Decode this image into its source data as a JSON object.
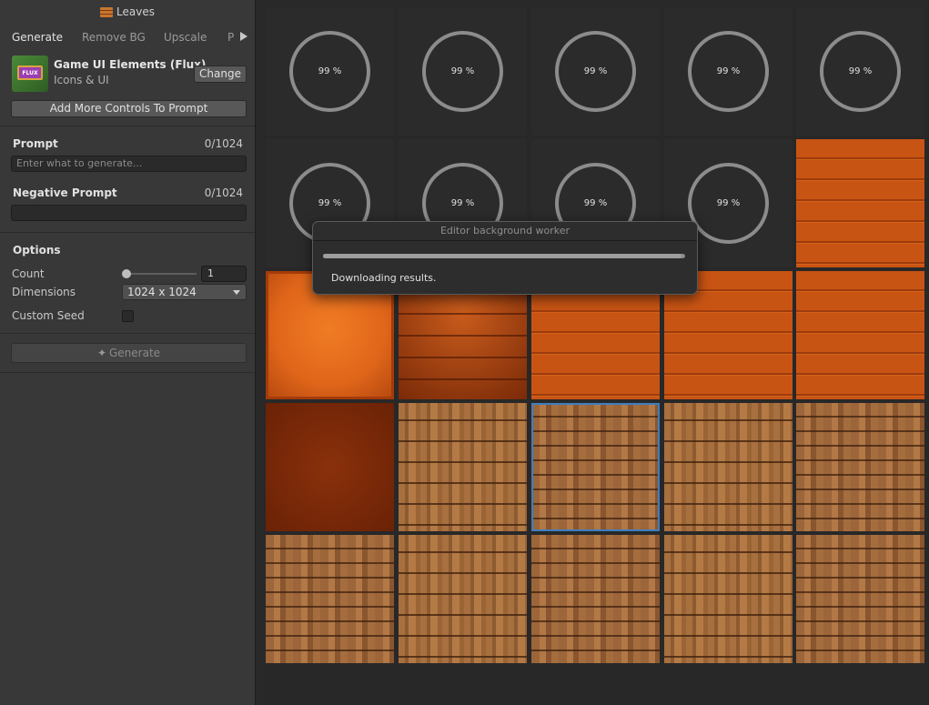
{
  "window": {
    "title": "Leaves"
  },
  "tabs": [
    "Generate",
    "Remove BG",
    "Upscale",
    "P"
  ],
  "model": {
    "name": "Game UI Elements (Flux)",
    "subtitle": "Icons & UI",
    "badge": "FLUX",
    "change_label": "Change"
  },
  "add_controls_label": "Add More Controls To Prompt",
  "prompt": {
    "label": "Prompt",
    "counter": "0/1024",
    "placeholder": "Enter what to generate..."
  },
  "negative_prompt": {
    "label": "Negative Prompt",
    "counter": "0/1024",
    "value": ""
  },
  "options": {
    "label": "Options",
    "count_label": "Count",
    "count_value": "1",
    "dimensions_label": "Dimensions",
    "dimensions_value": "1024 x 1024",
    "seed_label": "Custom Seed",
    "seed_checked": false
  },
  "generate_label": "Generate",
  "grid": {
    "tiles": [
      {
        "kind": "loading",
        "progress": "99 %"
      },
      {
        "kind": "loading",
        "progress": "99 %"
      },
      {
        "kind": "loading",
        "progress": "99 %"
      },
      {
        "kind": "loading",
        "progress": "99 %"
      },
      {
        "kind": "loading",
        "progress": "99 %"
      },
      {
        "kind": "loading",
        "progress": "99 %"
      },
      {
        "kind": "loading",
        "progress": "99 %"
      },
      {
        "kind": "loading",
        "progress": "99 %"
      },
      {
        "kind": "loading",
        "progress": "99 %"
      },
      {
        "kind": "orange-planks"
      },
      {
        "kind": "orange-flat"
      },
      {
        "kind": "orange-dark"
      },
      {
        "kind": "orange-planks"
      },
      {
        "kind": "orange-planks"
      },
      {
        "kind": "orange-planks"
      },
      {
        "kind": "dark-red"
      },
      {
        "kind": "wood-a"
      },
      {
        "kind": "wood-b",
        "selected": true
      },
      {
        "kind": "wood-a"
      },
      {
        "kind": "wood-b"
      },
      {
        "kind": "wood-b"
      },
      {
        "kind": "wood-a"
      },
      {
        "kind": "wood-b"
      },
      {
        "kind": "wood-a"
      },
      {
        "kind": "wood-b"
      }
    ]
  },
  "dialog": {
    "title": "Editor background worker",
    "message": "Downloading results.",
    "progress": 0.99
  }
}
